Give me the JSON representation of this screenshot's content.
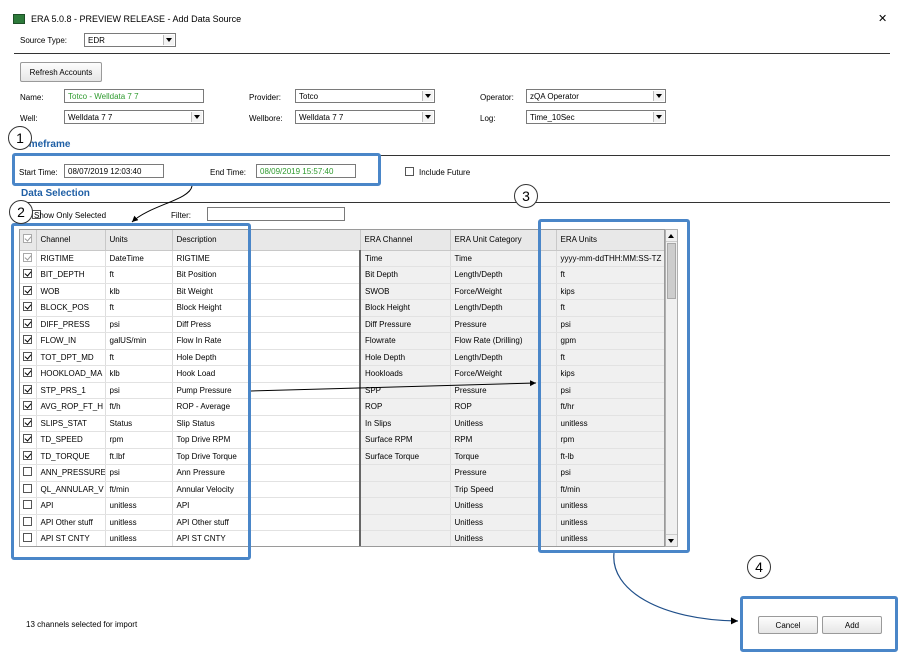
{
  "window": {
    "title": "ERA 5.0.8 - PREVIEW RELEASE - Add Data Source",
    "close_glyph": "✕"
  },
  "source_type": {
    "label": "Source Type:",
    "value": "EDR"
  },
  "refresh_button": "Refresh Accounts",
  "fields": {
    "name": {
      "label": "Name:",
      "value": "Totco - Welldata 7 7"
    },
    "provider": {
      "label": "Provider:",
      "value": "Totco"
    },
    "operator": {
      "label": "Operator:",
      "value": "zQA Operator"
    },
    "well": {
      "label": "Well:",
      "value": "Welldata 7 7"
    },
    "wellbore": {
      "label": "Wellbore:",
      "value": "Welldata 7 7"
    },
    "log": {
      "label": "Log:",
      "value": "Time_10Sec"
    }
  },
  "timeframe": {
    "heading": "Timeframe",
    "start_label": "Start Time:",
    "start_value": "08/07/2019 12:03:40",
    "end_label": "End Time:",
    "end_value": "08/09/2019 15:57:40",
    "include_future": "Include Future"
  },
  "data_selection": {
    "heading": "Data Selection",
    "show_only_selected": "Show Only Selected",
    "filter_label": "Filter:",
    "filter_value": ""
  },
  "table": {
    "headers": [
      "Channel",
      "Units",
      "Description",
      "ERA Channel",
      "ERA Unit Category",
      "ERA Units"
    ],
    "rows": [
      {
        "checked": true,
        "disabled": true,
        "cells": [
          "RIGTIME",
          "DateTime",
          "RIGTIME",
          "Time",
          "Time",
          "yyyy-mm-ddTHH:MM:SS-TZ"
        ]
      },
      {
        "checked": true,
        "disabled": false,
        "cells": [
          "BIT_DEPTH",
          "ft",
          "Bit Position",
          "Bit Depth",
          "Length/Depth",
          "ft"
        ]
      },
      {
        "checked": true,
        "disabled": false,
        "cells": [
          "WOB",
          "klb",
          "Bit Weight",
          "SWOB",
          "Force/Weight",
          "kips"
        ]
      },
      {
        "checked": true,
        "disabled": false,
        "cells": [
          "BLOCK_POS",
          "ft",
          "Block Height",
          "Block Height",
          "Length/Depth",
          "ft"
        ]
      },
      {
        "checked": true,
        "disabled": false,
        "cells": [
          "DIFF_PRESS",
          "psi",
          "Diff Press",
          "Diff Pressure",
          "Pressure",
          "psi"
        ]
      },
      {
        "checked": true,
        "disabled": false,
        "cells": [
          "FLOW_IN",
          "galUS/min",
          "Flow In Rate",
          "Flowrate",
          "Flow Rate (Drilling)",
          "gpm"
        ]
      },
      {
        "checked": true,
        "disabled": false,
        "cells": [
          "TOT_DPT_MD",
          "ft",
          "Hole Depth",
          "Hole Depth",
          "Length/Depth",
          "ft"
        ]
      },
      {
        "checked": true,
        "disabled": false,
        "cells": [
          "HOOKLOAD_MA",
          "klb",
          "Hook Load",
          "Hookloads",
          "Force/Weight",
          "kips"
        ]
      },
      {
        "checked": true,
        "disabled": false,
        "cells": [
          "STP_PRS_1",
          "psi",
          "Pump Pressure",
          "SPP",
          "Pressure",
          "psi"
        ]
      },
      {
        "checked": true,
        "disabled": false,
        "cells": [
          "AVG_ROP_FT_H",
          "ft/h",
          "ROP - Average",
          "ROP",
          "ROP",
          "ft/hr"
        ]
      },
      {
        "checked": true,
        "disabled": false,
        "cells": [
          "SLIPS_STAT",
          "Status",
          "Slip Status",
          "In Slips",
          "Unitless",
          "unitless"
        ]
      },
      {
        "checked": true,
        "disabled": false,
        "cells": [
          "TD_SPEED",
          "rpm",
          "Top Drive RPM",
          "Surface RPM",
          "RPM",
          "rpm"
        ]
      },
      {
        "checked": true,
        "disabled": false,
        "cells": [
          "TD_TORQUE",
          "ft.lbf",
          "Top Drive Torque",
          "Surface Torque",
          "Torque",
          "ft-lb"
        ]
      },
      {
        "checked": false,
        "disabled": false,
        "cells": [
          "ANN_PRESSURE",
          "psi",
          "Ann Pressure",
          "",
          "Pressure",
          "psi"
        ]
      },
      {
        "checked": false,
        "disabled": false,
        "cells": [
          "QL_ANNULAR_V",
          "ft/min",
          "Annular Velocity",
          "",
          "Trip Speed",
          "ft/min"
        ]
      },
      {
        "checked": false,
        "disabled": false,
        "cells": [
          "API",
          "unitless",
          "API",
          "",
          "Unitless",
          "unitless"
        ]
      },
      {
        "checked": false,
        "disabled": false,
        "cells": [
          "API Other stuff",
          "unitless",
          "API Other stuff",
          "",
          "Unitless",
          "unitless"
        ]
      },
      {
        "checked": false,
        "disabled": false,
        "cells": [
          "API ST CNTY",
          "unitless",
          "API ST CNTY",
          "",
          "Unitless",
          "unitless"
        ]
      }
    ]
  },
  "status": "13 channels selected for import",
  "buttons": {
    "cancel": "Cancel",
    "add": "Add"
  },
  "callouts": [
    "1",
    "2",
    "3",
    "4"
  ],
  "colors": {
    "callout": "#4a86c8",
    "section": "#1f5fa5",
    "green_text": "#2e9a2e"
  }
}
